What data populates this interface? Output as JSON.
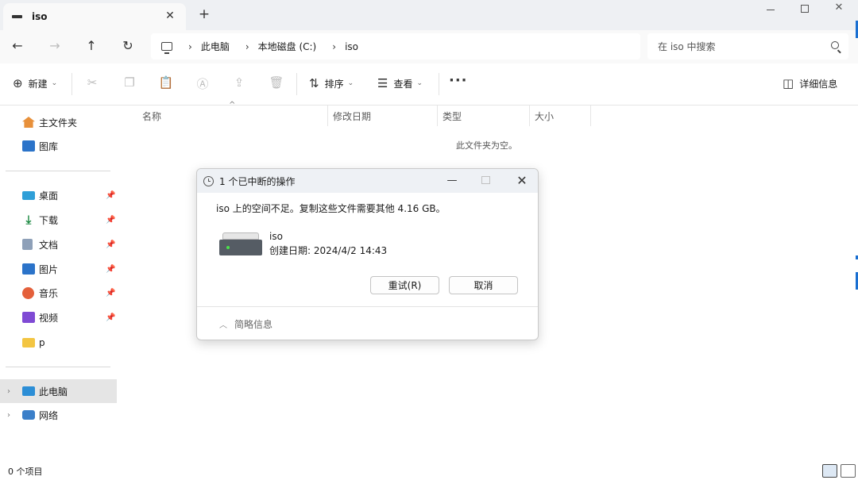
{
  "tab": {
    "title": "iso",
    "close": "✕",
    "add": "+"
  },
  "window": {
    "close": "✕"
  },
  "nav": {
    "back": "←",
    "forward": "→",
    "up": "↑",
    "refresh": "↻",
    "sep": "›",
    "breadcrumbs": [
      "此电脑",
      "本地磁盘 (C:)",
      "iso"
    ],
    "search_placeholder": "在 iso 中搜索"
  },
  "toolbar": {
    "new_label": "新建",
    "sort_label": "排序",
    "view_label": "查看",
    "more": "···",
    "details_label": "详细信息"
  },
  "sidebar": {
    "quick": [
      {
        "label": "主文件夹",
        "icon": "home-icon"
      },
      {
        "label": "图库",
        "icon": "gallery-icon"
      }
    ],
    "pinned": [
      {
        "label": "桌面",
        "icon": "desktop-icon"
      },
      {
        "label": "下载",
        "icon": "download-icon"
      },
      {
        "label": "文档",
        "icon": "document-icon"
      },
      {
        "label": "图片",
        "icon": "pictures-icon"
      },
      {
        "label": "音乐",
        "icon": "music-icon"
      },
      {
        "label": "视频",
        "icon": "video-icon"
      },
      {
        "label": "p",
        "icon": "folder-icon"
      }
    ],
    "tree": [
      {
        "label": "此电脑",
        "icon": "pc-icon",
        "selected": true
      },
      {
        "label": "网络",
        "icon": "network-icon",
        "selected": false
      }
    ]
  },
  "columns": {
    "name": "名称",
    "modified": "修改日期",
    "type": "类型",
    "size": "大小"
  },
  "content": {
    "empty_message": "此文件夹为空。"
  },
  "status": {
    "item_count": "0 个项目"
  },
  "dialog": {
    "title": "1 个已中断的操作",
    "message": "iso 上的空间不足。复制这些文件需要其他 4.16 GB。",
    "item_name": "iso",
    "item_date": "创建日期: 2024/4/2 14:43",
    "retry_label": "重试(R)",
    "cancel_label": "取消",
    "less_info_label": "简略信息",
    "close": "✕",
    "minimize": "—"
  }
}
